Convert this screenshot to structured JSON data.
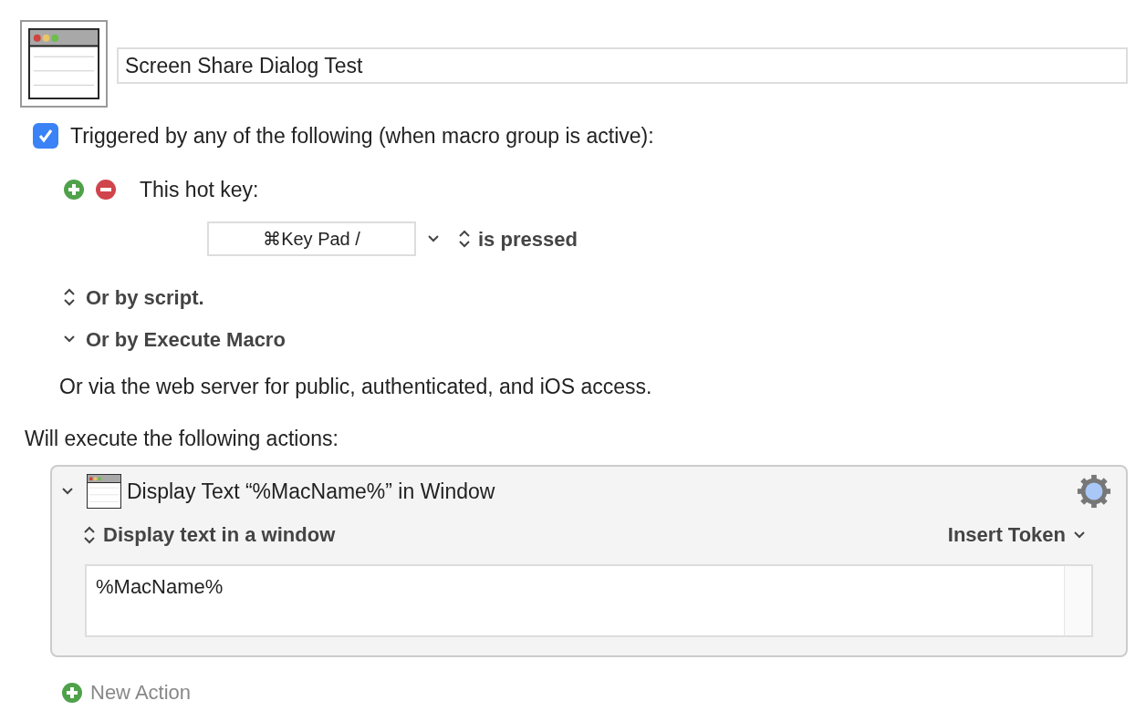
{
  "macro": {
    "name": "Screen Share Dialog Test"
  },
  "trigger": {
    "checked": true,
    "label": "Triggered by any of the following (when macro group is active):",
    "hotkey": {
      "label": "This hot key:",
      "key": "⌘Key Pad /",
      "mode": "is pressed"
    },
    "options": [
      {
        "kind": "popup",
        "label": "Or by script."
      },
      {
        "kind": "disclosure",
        "label": "Or by Execute Macro",
        "expanded": true
      }
    ],
    "web_note": "Or via the web server for public, authenticated, and iOS access."
  },
  "actions_label": "Will execute the following actions:",
  "actions": [
    {
      "title": "Display Text “%MacName%” in Window",
      "expanded": true,
      "mode": "Display text in a window",
      "token_button": "Insert Token",
      "text": "%MacName%"
    }
  ],
  "new_action": "New Action"
}
